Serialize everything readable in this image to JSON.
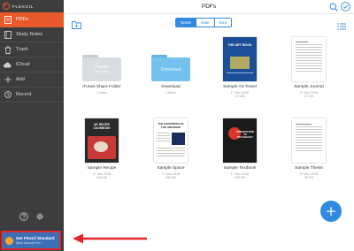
{
  "app": {
    "brand": "FLEXCIL",
    "accent_color": "#e85a2b",
    "primary_color": "#2f8ae0"
  },
  "sidebar": {
    "items": [
      {
        "label": "PDFs",
        "icon": "pdf-icon",
        "active": true
      },
      {
        "label": "Study Notes",
        "icon": "notebook-icon",
        "active": false
      },
      {
        "label": "Trash",
        "icon": "trash-icon",
        "active": false
      },
      {
        "label": "iCloud",
        "icon": "cloud-icon",
        "active": false
      },
      {
        "label": "Add",
        "icon": "plus-icon",
        "active": false
      },
      {
        "label": "Recent",
        "icon": "clock-icon",
        "active": false
      }
    ],
    "bottom_icons": [
      "help-icon",
      "settings-icon"
    ],
    "upgrade": {
      "title": "Get Flexcil Standard",
      "subtitle": "Save Annual Pro >"
    }
  },
  "header": {
    "title": "PDFs",
    "icons": [
      "search-icon",
      "select-check-icon"
    ]
  },
  "toolbar": {
    "sort_options": [
      "Name",
      "Date",
      "Size"
    ],
    "selected_sort": "Name",
    "icons": [
      "new-folder-icon",
      "list-view-icon"
    ]
  },
  "files": [
    {
      "name": "iTunes Share Folder",
      "meta": "0 Items",
      "kind": "folder",
      "folder_label": "iTunes",
      "folder_sub": "File Sharing",
      "color": "#d9dde2"
    },
    {
      "name": "Download",
      "meta": "0 Items",
      "kind": "folder",
      "folder_label": "Download",
      "color": "#74c1ee"
    },
    {
      "name": "Sample Art Travel",
      "meta": "17 Dec 2018\n1.4 MB",
      "kind": "doc",
      "cover_title": "THE ART BOOK",
      "cover": "#1d4f98"
    },
    {
      "name": "Sample Journal",
      "meta": "17 Dec 2018\n37 KB",
      "kind": "doc",
      "cover": "#ffffff"
    },
    {
      "name": "Sample Recipe",
      "meta": "17 Dec 2018\n640 KB",
      "kind": "doc",
      "cover_title": "MY RECIPE COOKBOOK",
      "cover": "#2a2a2a"
    },
    {
      "name": "Sample Space",
      "meta": "17 Dec 2018\n280 KB",
      "kind": "doc",
      "cover_title": "THE EXPANSION OF THE UNIVERSE",
      "cover": "#ffffff"
    },
    {
      "name": "Sample Textbook",
      "meta": "17 Dec 2018\n203 KB",
      "kind": "doc",
      "cover_title": "INTRODUCTION TO PSYCHOLOGY",
      "cover": "#1a1a1a"
    },
    {
      "name": "Sample Thesis",
      "meta": "17 Dec 2018\n90 KB",
      "kind": "doc",
      "cover": "#ffffff"
    }
  ],
  "fab": {
    "label": "+"
  }
}
